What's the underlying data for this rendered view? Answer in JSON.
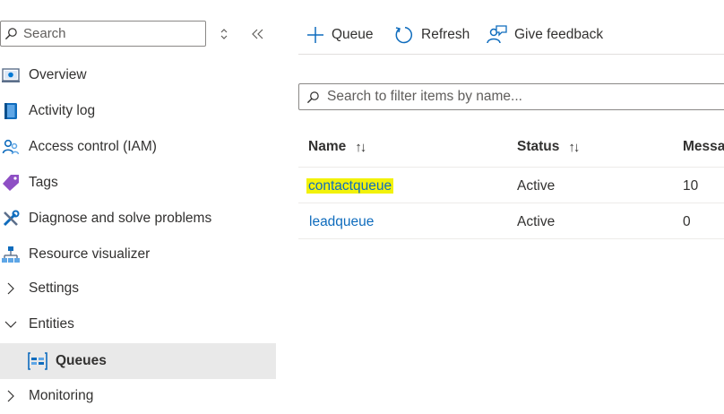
{
  "sidebar": {
    "search_placeholder": "Search",
    "items": [
      {
        "label": "Overview"
      },
      {
        "label": "Activity log"
      },
      {
        "label": "Access control (IAM)"
      },
      {
        "label": "Tags"
      },
      {
        "label": "Diagnose and solve problems"
      },
      {
        "label": "Resource visualizer"
      },
      {
        "label": "Settings"
      },
      {
        "label": "Entities"
      },
      {
        "label": "Queues"
      },
      {
        "label": "Monitoring"
      }
    ]
  },
  "toolbar": {
    "queue_label": "Queue",
    "refresh_label": "Refresh",
    "feedback_label": "Give feedback"
  },
  "filter": {
    "placeholder": "Search to filter items by name..."
  },
  "table": {
    "headers": {
      "name": "Name",
      "status": "Status",
      "messages": "Messa"
    },
    "rows": [
      {
        "name": "contactqueue",
        "status": "Active",
        "messages": "10"
      },
      {
        "name": "leadqueue",
        "status": "Active",
        "messages": "0"
      }
    ]
  },
  "colors": {
    "link": "#0f6cbd",
    "highlight": "#f2f20a",
    "selected_bg": "#e9e9e9"
  }
}
